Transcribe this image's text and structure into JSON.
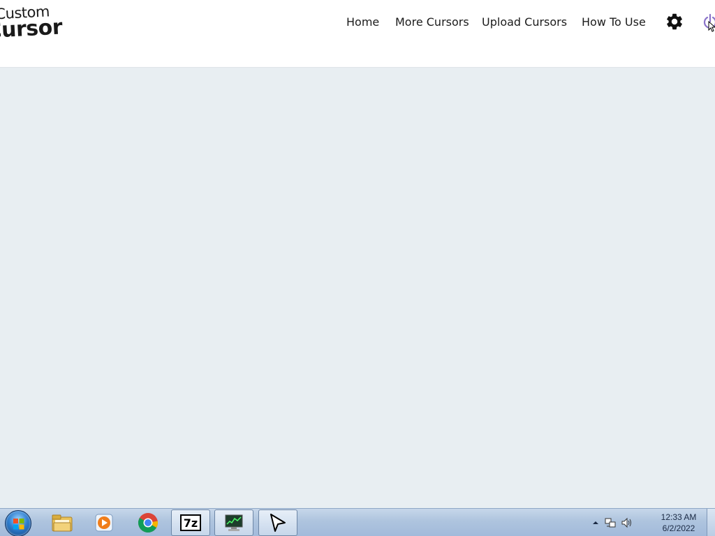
{
  "site": {
    "logo_line1": "Custom",
    "logo_line2": "Cursor"
  },
  "nav": {
    "items": [
      {
        "label": "Home"
      },
      {
        "label": "More Cursors"
      },
      {
        "label": "Upload Cursors"
      },
      {
        "label": "How To Use"
      }
    ],
    "settings_icon": "gear-icon",
    "power_icon": "power-icon"
  },
  "page": {
    "background": "#e8eef2",
    "edge_glyph": ":"
  },
  "taskbar": {
    "pinned": [
      {
        "name": "windows-explorer",
        "icon": "folder-icon"
      },
      {
        "name": "media-player",
        "icon": "media-player-icon"
      },
      {
        "name": "google-chrome",
        "icon": "chrome-icon"
      },
      {
        "name": "7-zip",
        "icon": "7zip-icon",
        "label": "7z"
      },
      {
        "name": "system-monitor",
        "icon": "monitor-icon"
      },
      {
        "name": "cursor-app",
        "icon": "cursor-arrow-icon"
      }
    ],
    "clock_time": "12:33 AM",
    "clock_date": "6/2/2022"
  },
  "colors": {
    "header_bg": "#ffffff",
    "body_bg": "#e8eef2",
    "power_accent": "#8b74c9",
    "taskbar": "#aec4de"
  }
}
